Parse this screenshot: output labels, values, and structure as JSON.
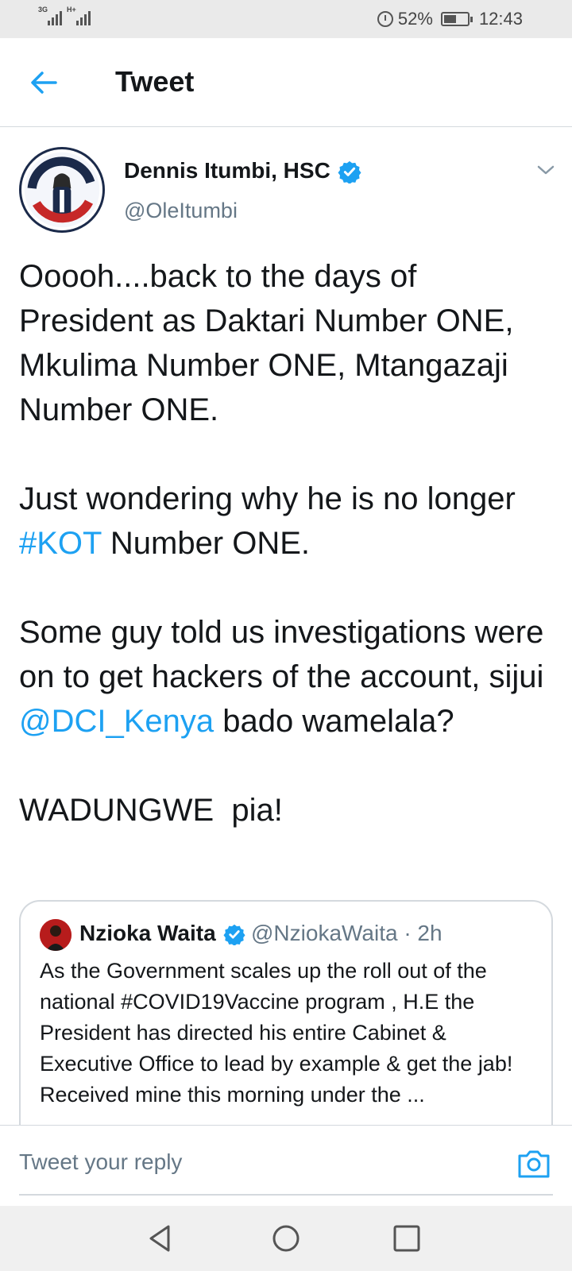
{
  "status_bar": {
    "signal1_tag": "3G",
    "signal2_tag": "H+",
    "battery_percent": "52%",
    "battery_level": 0.52,
    "time": "12:43"
  },
  "header": {
    "title": "Tweet"
  },
  "tweet": {
    "display_name": "Dennis Itumbi, HSC",
    "handle": "@OleItumbi",
    "avatar_text": "I'VE GOT YOUR BACK",
    "para1": "Ooooh....back to the days of President as Daktari Number ONE, Mkulima Number ONE, Mtangazaji Number ONE.",
    "para2_a": "Just wondering why he is no longer ",
    "para2_link": "#KOT",
    "para2_b": " Number ONE.",
    "para3_a": "Some guy told us investigations were on to get hackers of the account, sijui ",
    "para3_link": "@DCI_Kenya",
    "para3_b": " bado wamelala?",
    "para4": "WADUNGWE  pia!"
  },
  "quoted_tweet": {
    "display_name": "Nzioka Waita",
    "handle_time": "@NziokaWaita · 2h",
    "text": "As the Government scales up the roll out of the national #COVID19Vaccine  program , H.E the President has directed his entire Cabinet & Executive Office to lead by example & get the jab! Received mine this morning under the ..."
  },
  "reply": {
    "placeholder": "Tweet your reply"
  },
  "colors": {
    "accent": "#1da1f2",
    "secondary_text": "#657786",
    "border": "#d4d9de"
  },
  "icons": [
    "back-arrow-icon",
    "verified-badge-icon",
    "chevron-down-icon",
    "camera-icon",
    "nav-back-icon",
    "nav-home-icon",
    "nav-recents-icon"
  ]
}
